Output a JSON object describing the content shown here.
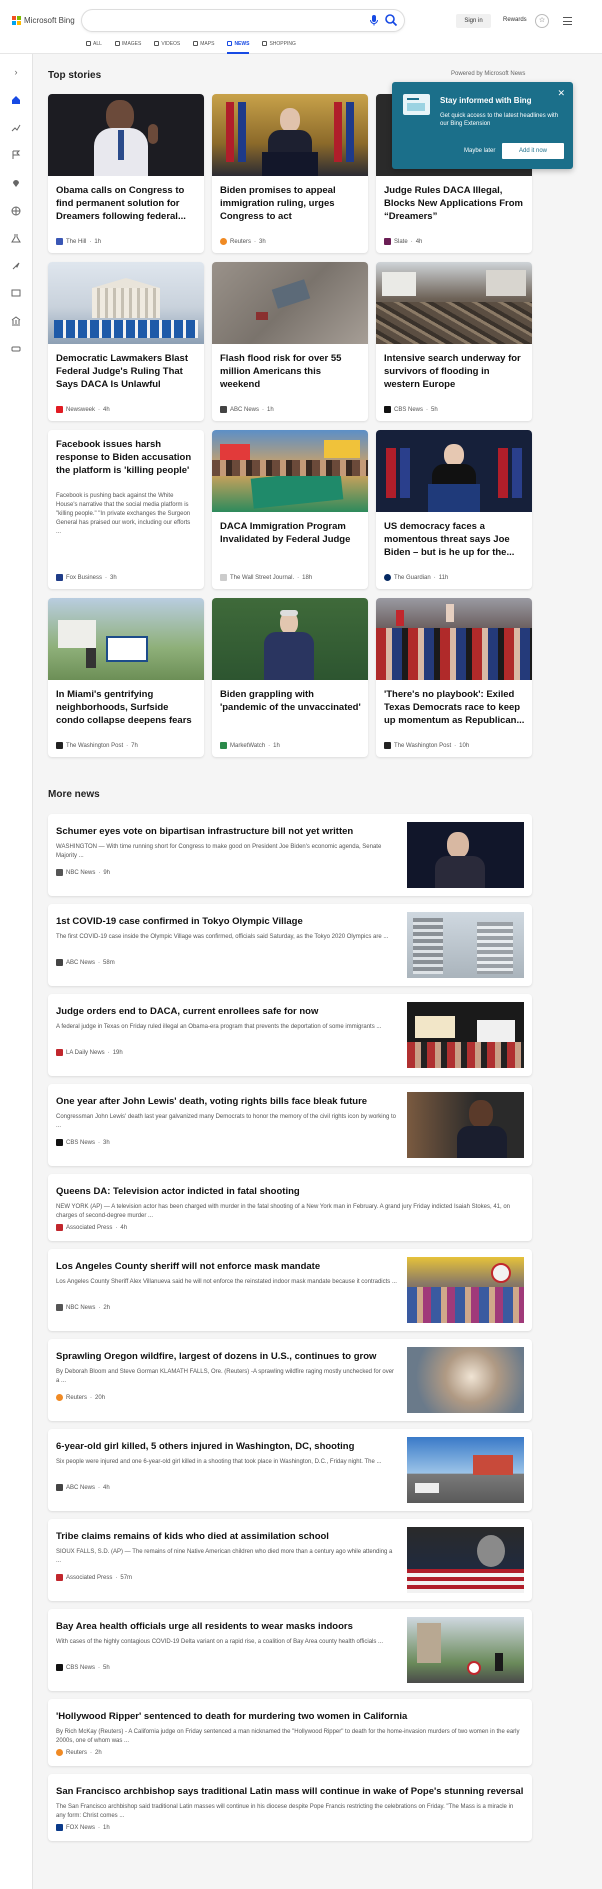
{
  "header": {
    "brand": "Microsoft Bing",
    "signin": "Sign in",
    "rewards": "Rewards"
  },
  "tabs": [
    "ALL",
    "IMAGES",
    "VIDEOS",
    "MAPS",
    "NEWS",
    "SHOPPING"
  ],
  "top_stories": {
    "title": "Top stories",
    "powered": "Powered by Microsoft News",
    "cards": [
      {
        "title": "Obama calls on Congress to find permanent solution for Dreamers following federal...",
        "source": "The Hill",
        "time": "1h"
      },
      {
        "title": "Biden promises to appeal immigration ruling, urges Congress to act",
        "source": "Reuters",
        "time": "3h"
      },
      {
        "title": "Judge Rules DACA Illegal, Blocks New Applications From “Dreamers”",
        "source": "Slate",
        "time": "4h"
      },
      {
        "title": "Democratic Lawmakers Blast Federal Judge's Ruling That Says DACA Is Unlawful",
        "source": "Newsweek",
        "time": "4h"
      },
      {
        "title": "Flash flood risk for over 55 million Americans this weekend",
        "source": "ABC News",
        "time": "1h"
      },
      {
        "title": "Intensive search underway for survivors of flooding in western Europe",
        "source": "CBS News",
        "time": "5h"
      },
      {
        "title": "Facebook issues harsh response to Biden accusation the platform is 'killing people'",
        "snippet": "Facebook is pushing back against the White House's narrative that the social media platform is \"killing people.\" \"In private exchanges the Surgeon General has praised our work, including our efforts ...",
        "source": "Fox Business",
        "time": "3h"
      },
      {
        "title": "DACA Immigration Program Invalidated by Federal Judge",
        "source": "The Wall Street Journal.",
        "time": "18h"
      },
      {
        "title": "US democracy faces a momentous threat says Joe Biden – but is he up for the...",
        "source": "The Guardian",
        "time": "11h"
      },
      {
        "title": "In Miami's gentrifying neighborhoods, Surfside condo collapse deepens fears of...",
        "source": "The Washington Post",
        "time": "7h"
      },
      {
        "title": "Biden grappling with 'pandemic of the unvaccinated'",
        "source": "MarketWatch",
        "time": "1h"
      },
      {
        "title": "'There's no playbook': Exiled Texas Democrats race to keep up momentum as Republican...",
        "source": "The Washington Post",
        "time": "10h"
      }
    ]
  },
  "popup": {
    "title": "Stay informed with Bing",
    "body": "Get quick access to the latest headlines with our Bing Extension",
    "later": "Maybe later",
    "add": "Add it now",
    "close": "✕"
  },
  "more_news": {
    "title": "More news",
    "items": [
      {
        "title": "Schumer eyes vote on bipartisan infrastructure bill not yet written",
        "snippet": "WASHINGTON — With time running short for Congress to make good on President Joe Biden's economic agenda, Senate Majority ...",
        "source": "NBC News",
        "time": "9h"
      },
      {
        "title": "1st COVID-19 case confirmed in Tokyo Olympic Village",
        "snippet": "The first COVID-19 case inside the Olympic Village was confirmed, officials said Saturday, as the Tokyo 2020 Olympics are ...",
        "source": "ABC News",
        "time": "58m"
      },
      {
        "title": "Judge orders end to DACA, current enrollees safe for now",
        "snippet": "A federal judge in Texas on Friday ruled illegal an Obama-era program that prevents the deportation of some immigrants ...",
        "source": "LA Daily News",
        "time": "19h"
      },
      {
        "title": "One year after John Lewis' death, voting rights bills face bleak future",
        "snippet": "Congressman John Lewis' death last year galvanized many Democrats to honor the memory of the civil rights icon by working to ...",
        "source": "CBS News",
        "time": "3h"
      },
      {
        "title": "Queens DA: Television actor indicted in fatal shooting",
        "snippet": "NEW YORK (AP) — A television actor has been charged with murder in the fatal shooting of a New York man in February. A grand jury Friday indicted Isaiah Stokes, 41, on charges of second-degree murder ...",
        "source": "Associated Press",
        "time": "4h"
      },
      {
        "title": "Los Angeles County sheriff will not enforce mask mandate",
        "snippet": "Los Angeles County Sheriff Alex Villanueva said he will not enforce the reinstated indoor mask mandate because it contradicts ...",
        "source": "NBC News",
        "time": "2h"
      },
      {
        "title": "Sprawling Oregon wildfire, largest of dozens in U.S., continues to grow",
        "snippet": "By Deborah Bloom and Steve Gorman KLAMATH FALLS, Ore. (Reuters) -A sprawling wildfire raging mostly unchecked for over a ...",
        "source": "Reuters",
        "time": "20h"
      },
      {
        "title": "6-year-old girl killed, 5 others injured in Washington, DC, shooting",
        "snippet": "Six people were injured and one 6-year-old girl killed in a shooting that took place in Washington, D.C., Friday night. The ...",
        "source": "ABC News",
        "time": "4h"
      },
      {
        "title": "Tribe claims remains of kids who died at assimilation school",
        "snippet": "SIOUX FALLS, S.D. (AP) — The remains of nine Native American children who died more than a century ago while attending a ...",
        "source": "Associated Press",
        "time": "57m"
      },
      {
        "title": "Bay Area health officials urge all residents to wear masks indoors",
        "snippet": "With cases of the highly contagious COVID-19 Delta variant on a rapid rise, a coalition of Bay Area county health officials ...",
        "source": "CBS News",
        "time": "5h"
      },
      {
        "title": "'Hollywood Ripper' sentenced to death for murdering two women in California",
        "snippet": "By Rich McKay (Reuters) - A California judge on Friday sentenced a man nicknamed the \"Hollywood Ripper\" to death for the home-invasion murders of two women in the early 2000s, one of whom was ...",
        "source": "Reuters",
        "time": "2h"
      },
      {
        "title": "San Francisco archbishop says traditional Latin mass will continue in wake of Pope's stunning reversal",
        "snippet": "The San Francisco archbishop said traditional Latin masses will continue in his diocese despite Pope Francis restricting the celebrations on Friday. \"The Mass is a miracle in any form: Christ comes ...",
        "source": "FOX News",
        "time": "1h"
      }
    ]
  },
  "colors": {
    "accent": "#174ae4",
    "popup": "#1b6f8a"
  },
  "icons": [
    "search-icon",
    "mic-icon",
    "medal-icon",
    "menu-icon",
    "home-icon",
    "globe-icon",
    "close-icon"
  ]
}
